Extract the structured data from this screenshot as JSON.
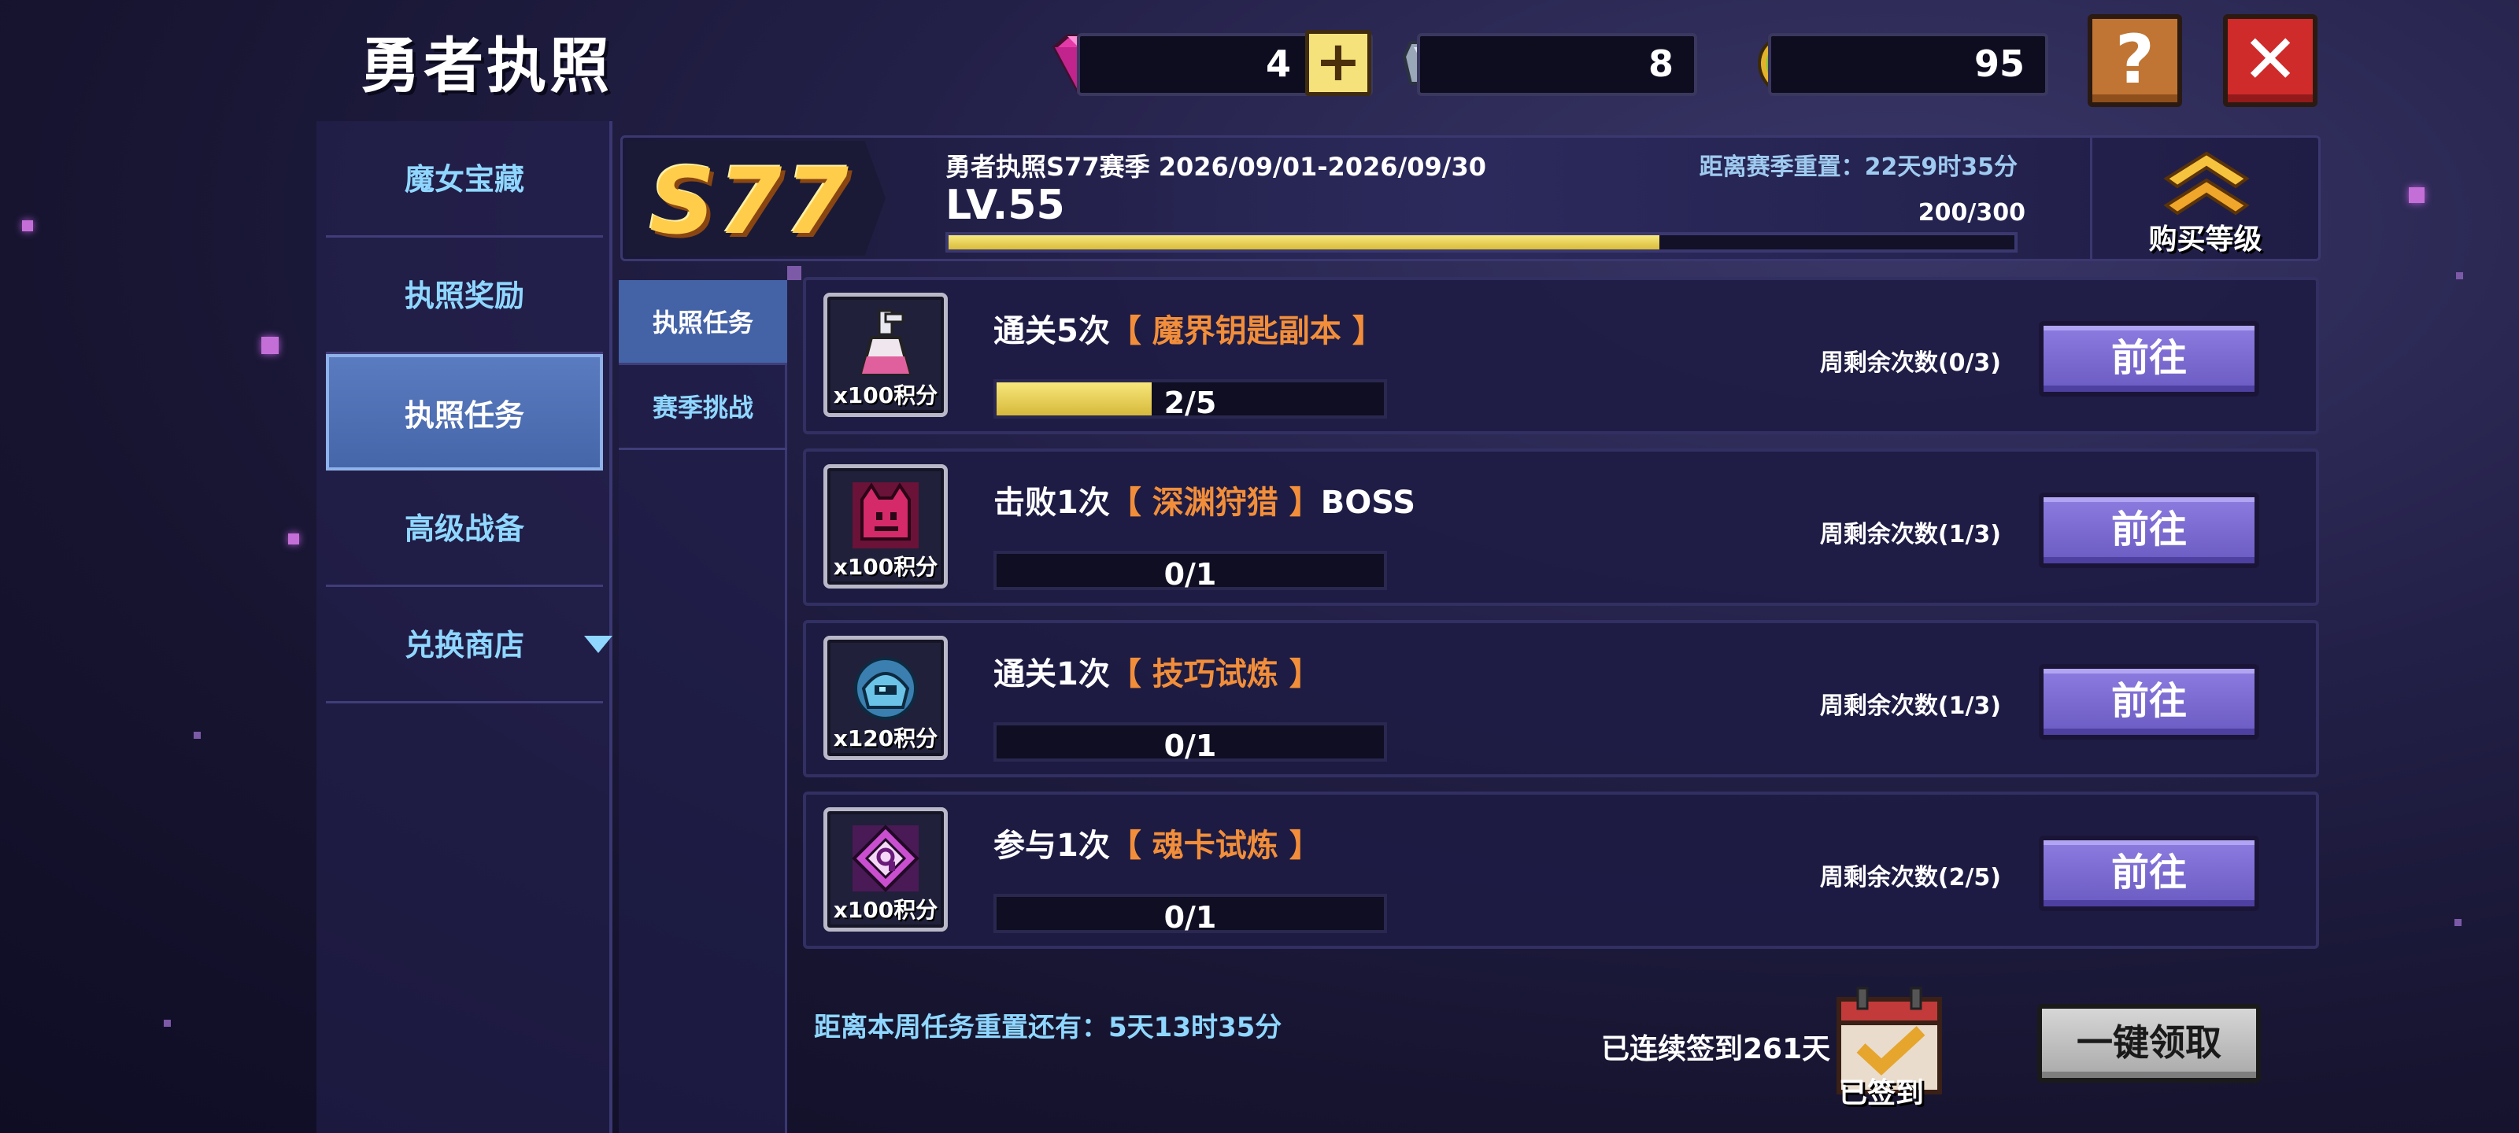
{
  "header": {
    "title": "勇者执照",
    "gems": "4",
    "plus": "+",
    "ore": "8",
    "seeds": "95",
    "help": "?",
    "close": "✕"
  },
  "leftnav": {
    "items": [
      {
        "label": "魔女宝藏"
      },
      {
        "label": "执照奖励"
      },
      {
        "label": "执照任务"
      },
      {
        "label": "高级战备"
      },
      {
        "label": "兑换商店"
      }
    ],
    "active_index": 2
  },
  "subnav": {
    "items": [
      {
        "label": "执照任务"
      },
      {
        "label": "赛季挑战"
      }
    ],
    "active_index": 0
  },
  "season": {
    "badge": "S77",
    "info": "勇者执照S77赛季 2026/09/01-2026/09/30",
    "reset": "距离赛季重置：22天9时35分",
    "level": "LV.55",
    "exp_text": "200/300",
    "exp_fraction": 0.667,
    "buy_label": "购买等级"
  },
  "tasks": [
    {
      "points": "x100积分",
      "prefix": "通关5次",
      "highlight": "【 魔界钥匙副本 】",
      "suffix": "",
      "progress_text": "2/5",
      "progress": 0.4,
      "weekly": "周剩余次数(0/3)",
      "button": "前往",
      "icon": "potion-icon"
    },
    {
      "points": "x100积分",
      "prefix": "击败1次",
      "highlight": "【 深渊狩猎 】",
      "suffix": "BOSS",
      "progress_text": "0/1",
      "progress": 0,
      "weekly": "周剩余次数(1/3)",
      "button": "前往",
      "icon": "demon-icon"
    },
    {
      "points": "x120积分",
      "prefix": "通关1次",
      "highlight": "【 技巧试炼 】",
      "suffix": "",
      "progress_text": "0/1",
      "progress": 0,
      "weekly": "周剩余次数(1/3)",
      "button": "前往",
      "icon": "helmet-icon"
    },
    {
      "points": "x100积分",
      "prefix": "参与1次",
      "highlight": "【 魂卡试炼 】",
      "suffix": "",
      "progress_text": "0/1",
      "progress": 0,
      "weekly": "周剩余次数(2/5)",
      "button": "前往",
      "icon": "soul-card-icon"
    }
  ],
  "footer": {
    "reset_week": "距离本周任务重置还有：5天13时35分",
    "checkin": "已连续签到261天",
    "signed": "已签到",
    "claim_all": "一键领取"
  },
  "colors": {
    "highlight": "#f28e3a",
    "nav_text": "#8fd7ff",
    "active_nav": "#4666aa",
    "go_button": "#7b6bd2",
    "exp_fill": "#e8d45a"
  }
}
